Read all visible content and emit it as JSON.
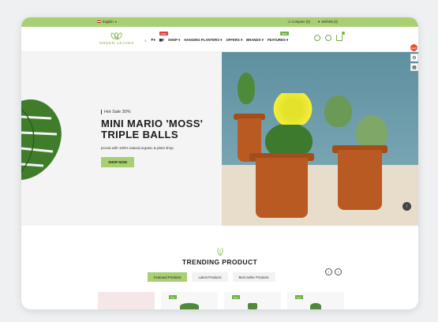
{
  "topbar": {
    "language": "English",
    "compare": "Compare (0)",
    "wishlist": "Wishlist (0)"
  },
  "logo": {
    "name": "GREEN LEAVES"
  },
  "nav": {
    "badge_top": "NEW",
    "badge_features": "NEW",
    "items": [
      {
        "label": "SHOP"
      },
      {
        "label": "HANGING PLANTERS"
      },
      {
        "label": "OFFERS"
      },
      {
        "label": "BRANDS"
      },
      {
        "label": "FEATURES"
      }
    ]
  },
  "hero": {
    "hot": "Hot Sale 30%",
    "title_line1": "MINI MARIO 'MOSS'",
    "title_line2": "TRIPLE BALLS",
    "subtitle": "pronia with 100% natural,organic & plant shop",
    "cta": "SHOP NOW"
  },
  "side": {
    "new_badge": "NEW"
  },
  "section": {
    "title": "TRENDING PRODUCT",
    "tabs": [
      {
        "label": "Featured Products"
      },
      {
        "label": "Latest Products"
      },
      {
        "label": "Best Seller Products"
      }
    ]
  },
  "products": {
    "new_label": "New"
  },
  "colors": {
    "accent": "#a8cf72",
    "brand": "#7aa843"
  }
}
